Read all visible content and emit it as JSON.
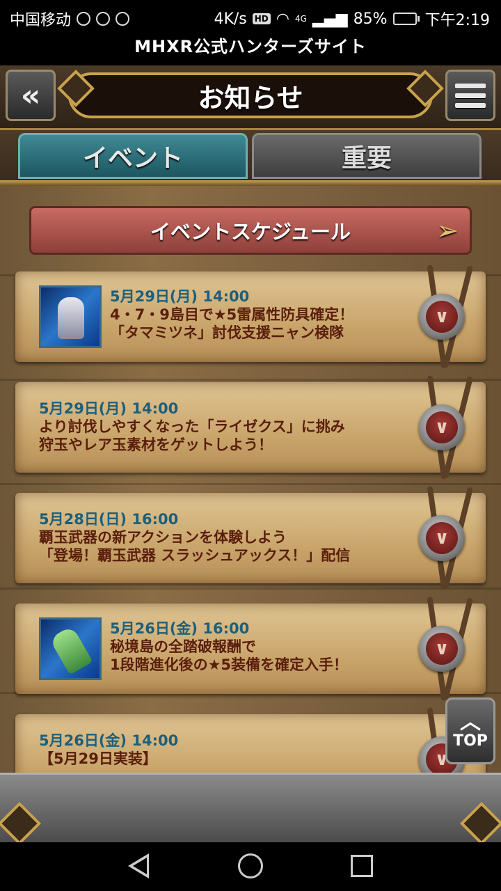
{
  "status_bar": {
    "carrier": "中国移动",
    "speed": "4K/s",
    "hd": "HD",
    "network": "4G",
    "battery": "85%",
    "battery_level": 0.85,
    "time": "下午2:19"
  },
  "site_title": "MHXR公式ハンターズサイト",
  "header": {
    "title": "お知らせ",
    "back_icon": "back-arrow-icon",
    "menu_icon": "hamburger-menu-icon"
  },
  "tabs": [
    {
      "label": "イベント",
      "active": true
    },
    {
      "label": "重要",
      "active": false
    }
  ],
  "schedule_button": {
    "label": "イベントスケジュール"
  },
  "news": [
    {
      "date": "5月29日(月) 14:00",
      "lines": [
        "4・7・9島目で★5雷属性防具確定！",
        "「タマミツネ」討伐支援ニャン検隊"
      ],
      "thumb": "armor"
    },
    {
      "date": "5月29日(月) 14:00",
      "lines": [
        "より討伐しやすくなった「ライゼクス」に挑み",
        "狩玉やレア玉素材をゲットしよう！"
      ]
    },
    {
      "date": "5月28日(日) 16:00",
      "lines": [
        "覇玉武器の新アクションを体験しよう",
        "「登場！覇玉武器 スラッシュアックス！」配信"
      ]
    },
    {
      "date": "5月26日(金) 16:00",
      "lines": [
        "秘境島の全踏破報酬で",
        "1段階進化後の★5装備を確定入手！"
      ],
      "thumb": "weapon"
    },
    {
      "date": "5月26日(金) 14:00",
      "lines": [
        "【5月29日実装】"
      ]
    }
  ],
  "top_button": {
    "label": "TOP"
  },
  "colors": {
    "date": "#1d5f7a",
    "text": "#5a1e0c",
    "gold": "#c9a24e"
  }
}
